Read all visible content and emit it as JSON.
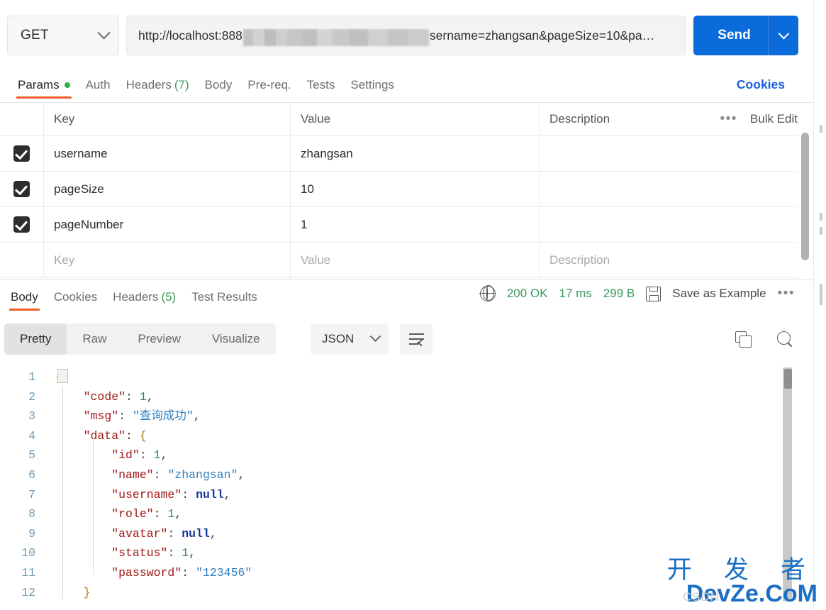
{
  "request": {
    "method": "GET",
    "method_chevron_icon": "chevron-down-icon",
    "url_prefix": "http://localhost:888",
    "url_redacted": "[redacted]",
    "url_suffix": "sername=zhangsan&pageSize=10&pa",
    "url_ellipsis": "…",
    "send_label": "Send",
    "send_chevron_icon": "chevron-down-icon"
  },
  "request_tabs": {
    "cookies_link": "Cookies",
    "items": [
      {
        "label": "Params",
        "active": true,
        "dot": true
      },
      {
        "label": "Auth",
        "active": false
      },
      {
        "label": "Headers",
        "count": "(7)",
        "active": false
      },
      {
        "label": "Body",
        "active": false
      },
      {
        "label": "Pre-req.",
        "active": false
      },
      {
        "label": "Tests",
        "active": false
      },
      {
        "label": "Settings",
        "active": false
      }
    ]
  },
  "params_table": {
    "headers": {
      "key": "Key",
      "value": "Value",
      "description": "Description"
    },
    "bulk_edit_label": "Bulk Edit",
    "more_icon": "ellipsis-icon",
    "rows": [
      {
        "checked": true,
        "key": "username",
        "value": "zhangsan",
        "description": ""
      },
      {
        "checked": true,
        "key": "pageSize",
        "value": "10",
        "description": ""
      },
      {
        "checked": true,
        "key": "pageNumber",
        "value": "1",
        "description": ""
      }
    ],
    "empty_row": {
      "key_placeholder": "Key",
      "value_placeholder": "Value",
      "description_placeholder": "Description"
    }
  },
  "response_tabs": {
    "items": [
      {
        "label": "Body",
        "active": true
      },
      {
        "label": "Cookies",
        "active": false
      },
      {
        "label": "Headers",
        "count": "(5)",
        "active": false
      },
      {
        "label": "Test Results",
        "active": false
      }
    ]
  },
  "response_status": {
    "globe_icon": "globe-icon",
    "status": "200 OK",
    "time": "17 ms",
    "size": "299 B",
    "save_icon": "save-icon",
    "save_as_example": "Save as Example",
    "more_icon": "ellipsis-icon",
    "status_color": "#3a9b5c"
  },
  "viewer_toolbar": {
    "modes": [
      {
        "label": "Pretty",
        "active": true
      },
      {
        "label": "Raw",
        "active": false
      },
      {
        "label": "Preview",
        "active": false
      },
      {
        "label": "Visualize",
        "active": false
      }
    ],
    "format": "JSON",
    "format_chevron_icon": "chevron-down-icon",
    "wrap_icon": "wrap-lines-icon",
    "copy_icon": "copy-icon",
    "search_icon": "search-icon"
  },
  "response_body": {
    "language": "json",
    "line_numbers": [
      "1",
      "2",
      "3",
      "4",
      "5",
      "6",
      "7",
      "8",
      "9",
      "10",
      "11",
      "12"
    ],
    "lines": [
      {
        "n": "1",
        "indent": 0,
        "tokens": [
          {
            "t": "{",
            "c": "br"
          }
        ]
      },
      {
        "n": "2",
        "indent": 1,
        "tokens": [
          {
            "t": "\"code\"",
            "c": "k"
          },
          {
            "t": ": ",
            "c": "p"
          },
          {
            "t": "1",
            "c": "n"
          },
          {
            "t": ",",
            "c": "p"
          }
        ]
      },
      {
        "n": "3",
        "indent": 1,
        "tokens": [
          {
            "t": "\"msg\"",
            "c": "k"
          },
          {
            "t": ": ",
            "c": "p"
          },
          {
            "t": "\"查询成功\"",
            "c": "s"
          },
          {
            "t": ",",
            "c": "p"
          }
        ]
      },
      {
        "n": "4",
        "indent": 1,
        "tokens": [
          {
            "t": "\"data\"",
            "c": "k"
          },
          {
            "t": ": ",
            "c": "p"
          },
          {
            "t": "{",
            "c": "br"
          }
        ]
      },
      {
        "n": "5",
        "indent": 2,
        "tokens": [
          {
            "t": "\"id\"",
            "c": "k"
          },
          {
            "t": ": ",
            "c": "p"
          },
          {
            "t": "1",
            "c": "n"
          },
          {
            "t": ",",
            "c": "p"
          }
        ]
      },
      {
        "n": "6",
        "indent": 2,
        "tokens": [
          {
            "t": "\"name\"",
            "c": "k"
          },
          {
            "t": ": ",
            "c": "p"
          },
          {
            "t": "\"zhangsan\"",
            "c": "s"
          },
          {
            "t": ",",
            "c": "p"
          }
        ]
      },
      {
        "n": "7",
        "indent": 2,
        "tokens": [
          {
            "t": "\"username\"",
            "c": "k"
          },
          {
            "t": ": ",
            "c": "p"
          },
          {
            "t": "null",
            "c": "nl"
          },
          {
            "t": ",",
            "c": "p"
          }
        ]
      },
      {
        "n": "8",
        "indent": 2,
        "tokens": [
          {
            "t": "\"role\"",
            "c": "k"
          },
          {
            "t": ": ",
            "c": "p"
          },
          {
            "t": "1",
            "c": "n"
          },
          {
            "t": ",",
            "c": "p"
          }
        ]
      },
      {
        "n": "9",
        "indent": 2,
        "tokens": [
          {
            "t": "\"avatar\"",
            "c": "k"
          },
          {
            "t": ": ",
            "c": "p"
          },
          {
            "t": "null",
            "c": "nl"
          },
          {
            "t": ",",
            "c": "p"
          }
        ]
      },
      {
        "n": "10",
        "indent": 2,
        "tokens": [
          {
            "t": "\"status\"",
            "c": "k"
          },
          {
            "t": ": ",
            "c": "p"
          },
          {
            "t": "1",
            "c": "n"
          },
          {
            "t": ",",
            "c": "p"
          }
        ]
      },
      {
        "n": "11",
        "indent": 2,
        "tokens": [
          {
            "t": "\"password\"",
            "c": "k"
          },
          {
            "t": ": ",
            "c": "p"
          },
          {
            "t": "\"123456\"",
            "c": "s"
          }
        ]
      },
      {
        "n": "12",
        "indent": 1,
        "tokens": [
          {
            "t": "}",
            "c": "br"
          }
        ]
      }
    ]
  },
  "watermark": {
    "cn": "开 发 者",
    "en": "DevZe.CoM",
    "csdn": "CSDN"
  }
}
